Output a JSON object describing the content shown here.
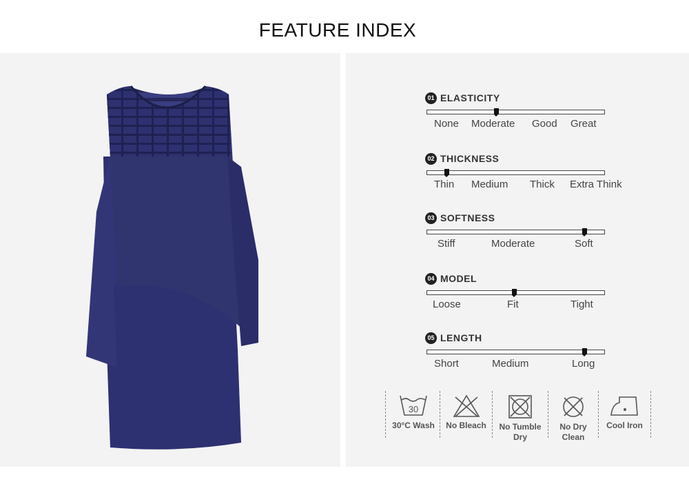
{
  "title": "FEATURE INDEX",
  "colors": {
    "panel_bg": "#f3f3f3",
    "dress": "#2c2f6e",
    "text": "#444444",
    "marker": "#111111"
  },
  "features": [
    {
      "num": "01",
      "name": "ELASTICITY",
      "options": [
        "None",
        "Moderate",
        "Good",
        "Great"
      ],
      "selected": "Moderate"
    },
    {
      "num": "02",
      "name": "THICKNESS",
      "options": [
        "Thin",
        "Medium",
        "Thick",
        "Extra Think"
      ],
      "selected": "Thin"
    },
    {
      "num": "03",
      "name": "SOFTNESS",
      "options": [
        "Stiff",
        "Moderate",
        "Soft"
      ],
      "selected": "Soft"
    },
    {
      "num": "04",
      "name": "MODEL",
      "options": [
        "Loose",
        "Fit",
        "Tight"
      ],
      "selected": "Fit"
    },
    {
      "num": "05",
      "name": "LENGTH",
      "options": [
        "Short",
        "Medium",
        "Long"
      ],
      "selected": "Long"
    }
  ],
  "care": [
    {
      "icon": "wash-30-icon",
      "temp": "30",
      "label_line1": "30°C Wash",
      "label_line2": ""
    },
    {
      "icon": "no-bleach-icon",
      "label_line1": "No Bleach",
      "label_line2": ""
    },
    {
      "icon": "no-tumble-dry-icon",
      "label_line1": "No Tumble",
      "label_line2": "Dry"
    },
    {
      "icon": "no-dry-clean-icon",
      "label_line1": "No Dry",
      "label_line2": "Clean"
    },
    {
      "icon": "cool-iron-icon",
      "label_line1": "Cool Iron",
      "label_line2": ""
    }
  ]
}
